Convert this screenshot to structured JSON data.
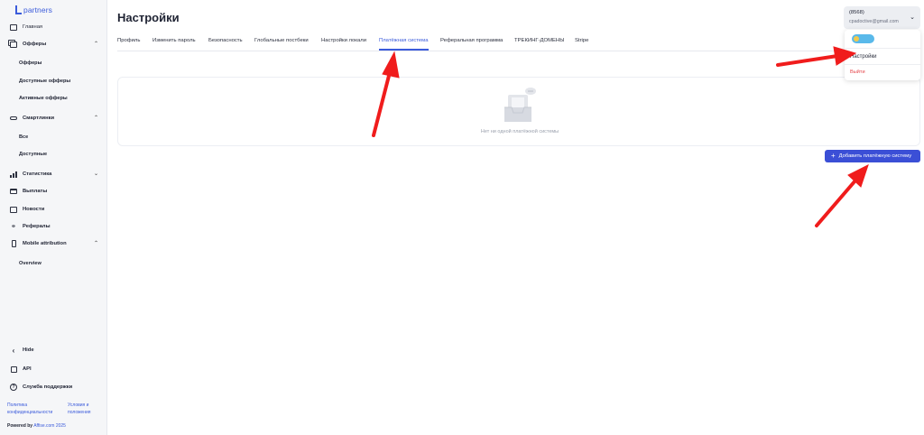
{
  "brand": {
    "logo_text": "partners"
  },
  "sidebar": {
    "items": [
      {
        "label": "Главная",
        "icon": "home-icon"
      },
      {
        "label": "Офферы",
        "icon": "offers-icon",
        "expanded": true
      },
      {
        "label": "Смартлинки",
        "icon": "link-icon",
        "expanded": true
      },
      {
        "label": "Статистика",
        "icon": "stats-icon",
        "expanded": false
      },
      {
        "label": "Выплаты",
        "icon": "card-icon"
      },
      {
        "label": "Новости",
        "icon": "news-icon"
      },
      {
        "label": "Рефералы",
        "icon": "referrals-icon"
      },
      {
        "label": "Mobile attribution",
        "icon": "phone-icon",
        "expanded": true
      }
    ],
    "offers_sub": [
      "Офферы",
      "Доступные офферы",
      "Активные офферы"
    ],
    "smartlinks_sub": [
      "Все",
      "Доступные"
    ],
    "mobile_sub": [
      "Overview"
    ],
    "bottom": {
      "hide": "Hide",
      "api": "API",
      "support": "Служба поддержки"
    },
    "footer": {
      "privacy": "Политика конфиденциальности",
      "terms": "Условия и положения",
      "powered_prefix": "Powered by",
      "powered_brand": "Affise.com 2025"
    }
  },
  "page": {
    "title": "Настройки"
  },
  "tabs": [
    "Профиль",
    "Изменить пароль",
    "Безопасность",
    "Глобальные постбеки",
    "Настройки локали",
    "Платёжная система",
    "Реферальная программа",
    "ТРЕКИНГ-ДОМЕНЫ",
    "Stripe"
  ],
  "active_tab": "Платёжная система",
  "empty_state": {
    "text": "Нет ни одной платёжной системы"
  },
  "add_button": {
    "label": "Добавить платёжную систему"
  },
  "account": {
    "id": "(8568)",
    "email": "cpadoctive@gmail.com",
    "menu": {
      "settings": "Настройки",
      "logout": "Выйти"
    }
  },
  "colors": {
    "accent": "#3b4fd6",
    "danger": "#e5484d",
    "annotation": "#f01c1c"
  }
}
